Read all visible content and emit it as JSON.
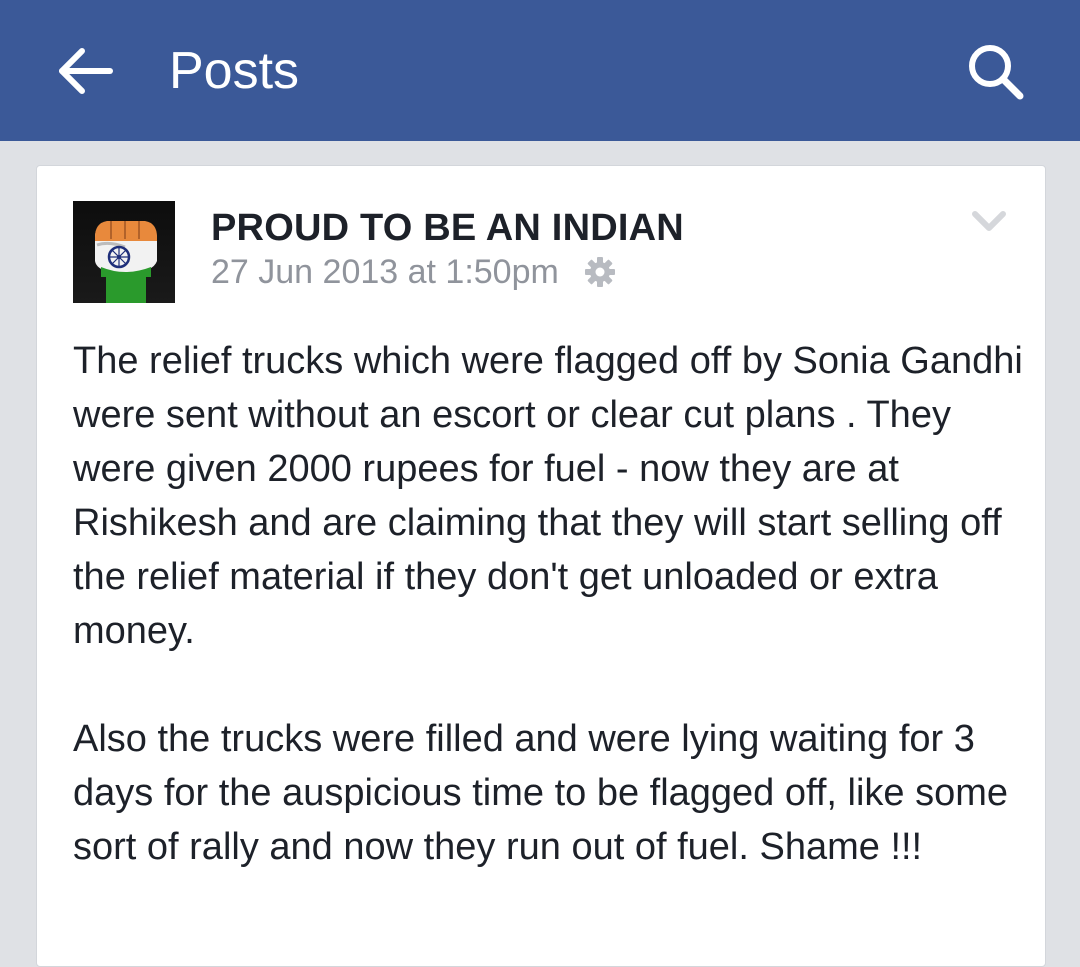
{
  "header": {
    "title": "Posts",
    "back_icon": "arrow-left-icon",
    "search_icon": "search-icon",
    "background_color": "#3b5998"
  },
  "post": {
    "author": "PROUD TO BE AN INDIAN",
    "timestamp": "27 Jun 2013 at 1:50pm",
    "privacy_icon": "gear-icon",
    "menu_icon": "chevron-down-icon",
    "paragraphs": [
      "The relief trucks which were flagged off by Sonia Gandhi were sent without an escort or clear cut plans . They were given 2000 rupees for fuel - now they are at Rishikesh and are claiming that they will start selling off the relief material if they don't get unloaded or extra money.",
      "Also the trucks were filled and were lying waiting for 3 days for the auspicious time to be flagged off, like some sort of rally and now they run out of fuel. Shame !!!"
    ]
  }
}
